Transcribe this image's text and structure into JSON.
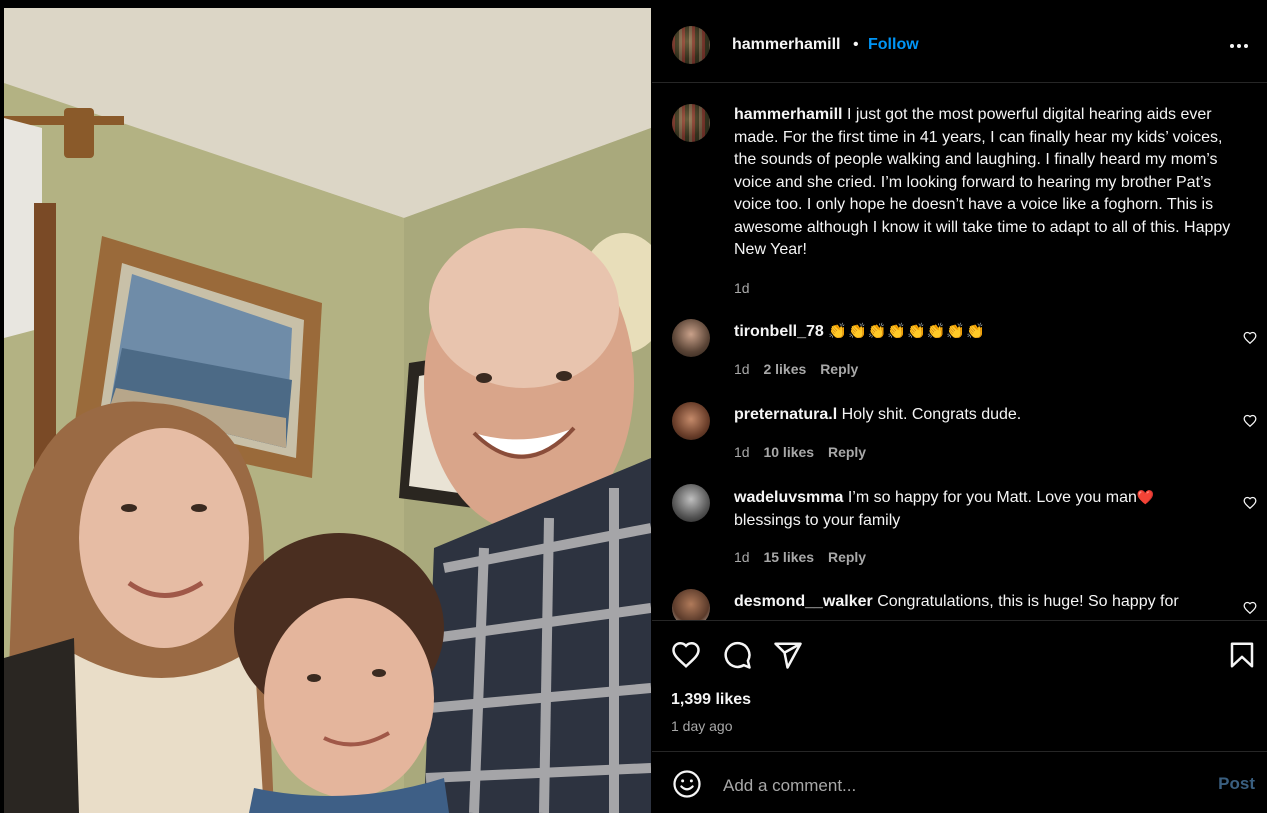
{
  "post": {
    "author": "hammerhamill",
    "follow_label": "Follow",
    "separator": "•",
    "caption": "I just got the most powerful digital hearing aids ever made. For the first time in 41 years, I can finally hear my kids’ voices, the sounds of people walking and laughing. I finally heard my mom’s voice and she cried. I’m looking forward to hearing my brother Pat’s voice too. I only hope he doesn’t have a voice like a foghorn. This is awesome although I know it will take time to adapt to all of this. Happy New Year!",
    "caption_time": "1d"
  },
  "comments": [
    {
      "user": "tironbell_78",
      "text": "👏👏👏👏👏👏👏👏",
      "time": "1d",
      "likes": "2 likes",
      "reply": "Reply"
    },
    {
      "user": "preternatura.l",
      "text": "Holy shit. Congrats dude.",
      "time": "1d",
      "likes": "10 likes",
      "reply": "Reply"
    },
    {
      "user": "wadeluvsmma",
      "text": "I’m so happy for you Matt. Love you man",
      "emoji": "❤️",
      "text2": "blessings to your family",
      "time": "1d",
      "likes": "15 likes",
      "reply": "Reply"
    },
    {
      "user": "desmond__walker",
      "text": "Congratulations, this is huge! So happy for"
    }
  ],
  "footer": {
    "likes": "1,399 likes",
    "posted": "1 day ago",
    "comment_placeholder": "Add a comment...",
    "post_label": "Post"
  },
  "icons": {
    "more": "more-horizontal-icon",
    "like": "heart-icon",
    "comment": "comment-icon",
    "share": "share-icon",
    "save": "bookmark-icon",
    "emoji": "emoji-icon"
  },
  "colors": {
    "background": "#000000",
    "follow": "#0095f6",
    "muted": "#a8a8a8",
    "heart": "#e0245e"
  }
}
